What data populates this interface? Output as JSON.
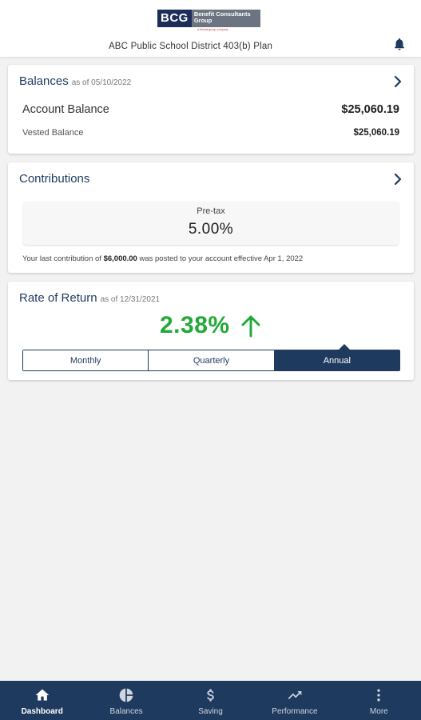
{
  "header": {
    "logo_mark": "BCG",
    "logo_text": "Benefit Consultants Group",
    "logo_tagline": "a Mutual group company",
    "plan_title": "ABC Public School District 403(b) Plan"
  },
  "balances": {
    "title": "Balances",
    "as_of": "as of 05/10/2022",
    "account_label": "Account Balance",
    "account_value": "$25,060.19",
    "vested_label": "Vested Balance",
    "vested_value": "$25,060.19"
  },
  "contributions": {
    "title": "Contributions",
    "pretax_label": "Pre-tax",
    "pretax_value": "5.00%",
    "note_prefix": "Your last contribution of",
    "note_amount": "$6,000.00",
    "note_suffix": "was posted to your account effective Apr 1, 2022"
  },
  "rate_of_return": {
    "title": "Rate of Return",
    "as_of": "as of 12/31/2021",
    "value": "2.38%",
    "trend": "up-arrow-icon",
    "periods": [
      "Monthly",
      "Quarterly",
      "Annual"
    ],
    "selected_period": "Annual"
  },
  "tabbar": {
    "items": [
      {
        "label": "Dashboard",
        "icon": "home-icon"
      },
      {
        "label": "Balances",
        "icon": "pie-chart-icon"
      },
      {
        "label": "Saving",
        "icon": "dollar-icon"
      },
      {
        "label": "Performance",
        "icon": "trend-icon"
      },
      {
        "label": "More",
        "icon": "more-vertical-icon"
      }
    ],
    "active": "Dashboard"
  },
  "colors": {
    "brand_navy": "#1f3a5f",
    "positive_green": "#22a93a",
    "background": "#f2f2f2"
  }
}
